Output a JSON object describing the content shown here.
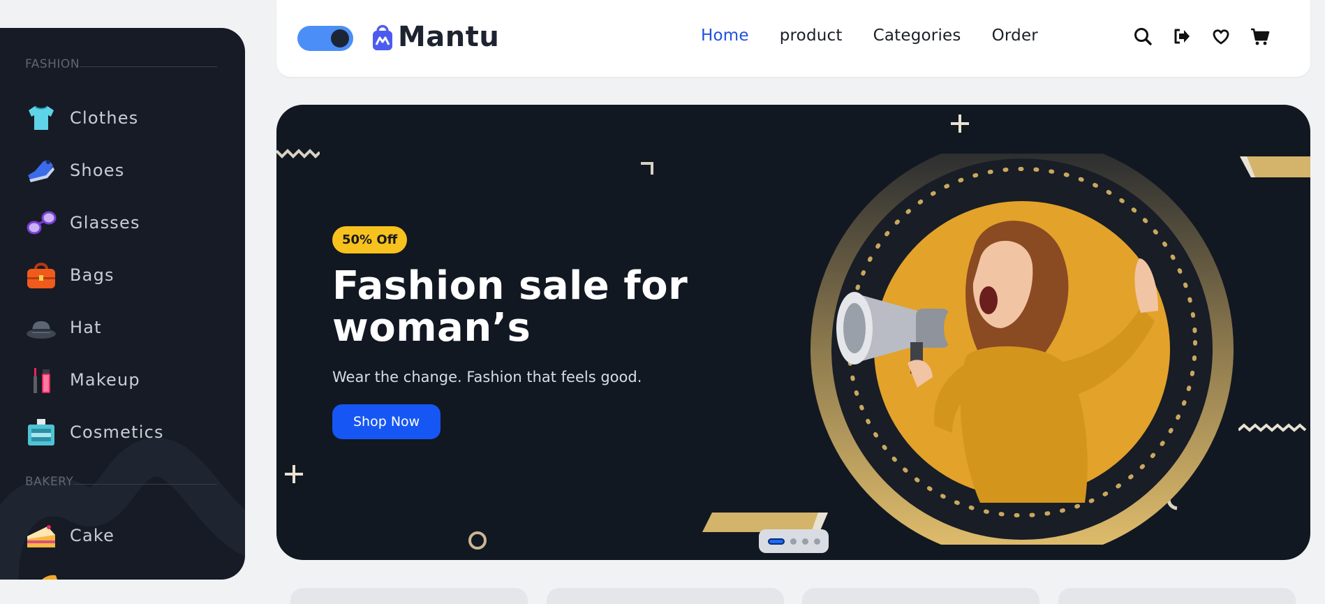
{
  "sidebar": {
    "sections": [
      {
        "title": "FASHION"
      },
      {
        "title": "BAKERY"
      }
    ],
    "items": [
      {
        "label": "Clothes",
        "icon": "tshirt-icon"
      },
      {
        "label": "Shoes",
        "icon": "shoe-icon"
      },
      {
        "label": "Glasses",
        "icon": "glasses-icon"
      },
      {
        "label": "Bags",
        "icon": "bag-icon"
      },
      {
        "label": "Hat",
        "icon": "hat-icon"
      },
      {
        "label": "Makeup",
        "icon": "lipstick-icon"
      },
      {
        "label": "Cosmetics",
        "icon": "cosmetics-icon"
      },
      {
        "label": "Cake",
        "icon": "cake-icon"
      }
    ]
  },
  "header": {
    "brand": "Mantu",
    "nav": [
      {
        "label": "Home",
        "active": true
      },
      {
        "label": "product",
        "active": false
      },
      {
        "label": "Categories",
        "active": false
      },
      {
        "label": "Order",
        "active": false
      }
    ],
    "icons": [
      "search-icon",
      "logout-icon",
      "heart-icon",
      "cart-icon"
    ],
    "theme_toggle": "dark"
  },
  "hero": {
    "badge": "50% Off",
    "title": "Fashion sale for woman’s",
    "subtitle": "Wear the change. Fashion that feels good.",
    "cta": "Shop Now",
    "slides_total": 4,
    "active_slide": 1
  },
  "colors": {
    "accent": "#1656f4",
    "badge": "#f7c21e",
    "hero_bg": "#121821",
    "sidebar_bg": "#161b25",
    "gold": "#d4b46a"
  }
}
